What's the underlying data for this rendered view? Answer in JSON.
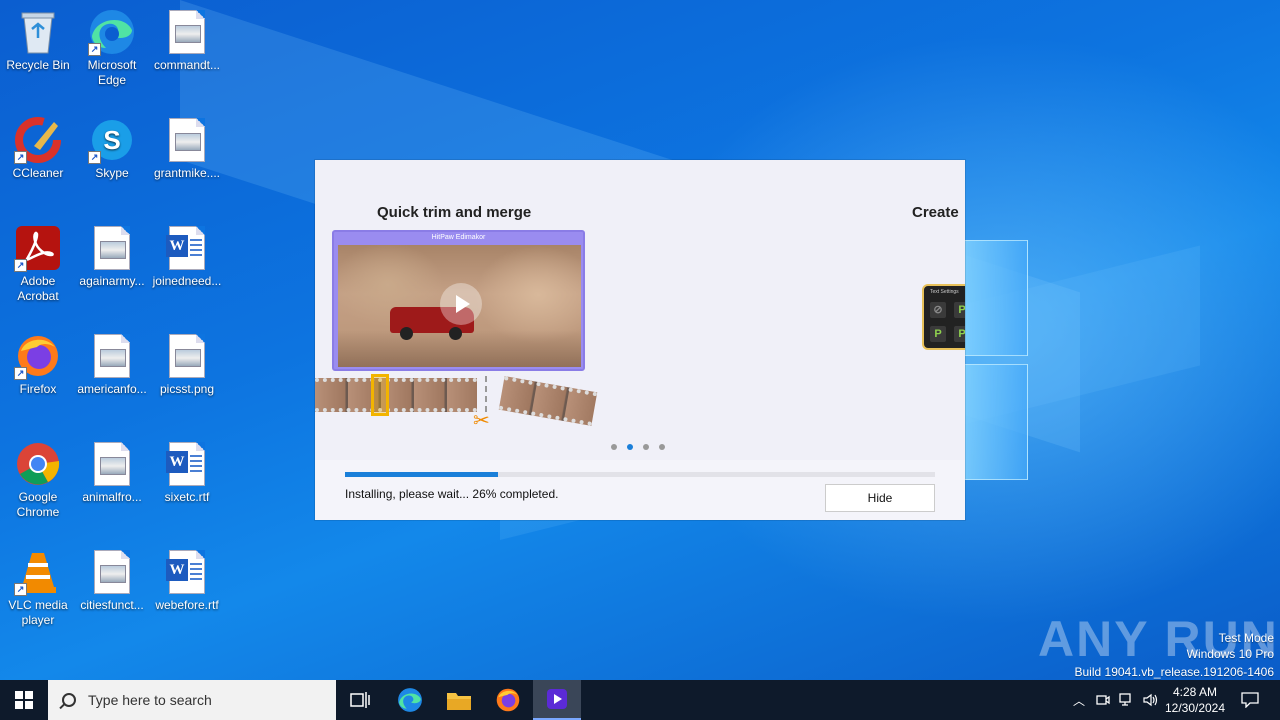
{
  "desktop": {
    "icons": [
      {
        "label": "Recycle Bin"
      },
      {
        "label": "Microsoft Edge"
      },
      {
        "label": "commandt..."
      },
      {
        "label": "CCleaner"
      },
      {
        "label": "Skype"
      },
      {
        "label": "grantmike...."
      },
      {
        "label": "Adobe Acrobat"
      },
      {
        "label": "againarmy..."
      },
      {
        "label": "joinedneed..."
      },
      {
        "label": "Firefox"
      },
      {
        "label": "americanfo..."
      },
      {
        "label": "picsst.png"
      },
      {
        "label": "Google Chrome"
      },
      {
        "label": "animalfro..."
      },
      {
        "label": "sixetc.rtf"
      },
      {
        "label": "VLC media player"
      },
      {
        "label": "citiesfunct..."
      },
      {
        "label": "webefore.rtf"
      }
    ]
  },
  "installer": {
    "slide_title_left": "Quick trim and merge",
    "slide_title_right": "Create",
    "preview_bar_title": "HitPaw Edimakor",
    "right_card_header": "Text Settings",
    "right_card_glyph": "P",
    "active_slide": 2,
    "slide_count": 4,
    "progress_percent": 26,
    "status_text": "Installing, please wait... 26% completed.",
    "hide_label": "Hide"
  },
  "watermark": {
    "text": "ANY RUN",
    "mode": "Test Mode",
    "os": "Windows 10 Pro",
    "build": "Build 19041.vb_release.191206-1406"
  },
  "taskbar": {
    "search_placeholder": "Type here to search",
    "time": "4:28 AM",
    "date": "12/30/2024"
  },
  "colors": {
    "accent": "#1a7fd9",
    "taskbar": "#0e1a2b",
    "preview_frame": "#9a8cf0"
  }
}
